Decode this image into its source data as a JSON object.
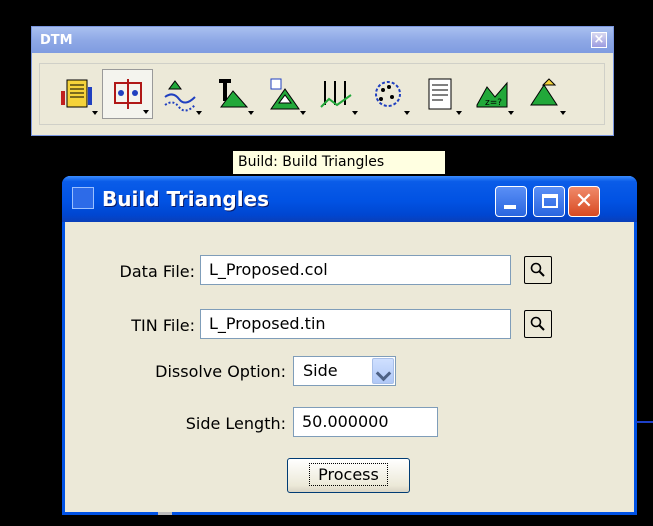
{
  "toolbar_window": {
    "title": "DTM",
    "close_glyph": "×",
    "tools": [
      {
        "icon": "input-data-icon",
        "label": "Input"
      },
      {
        "icon": "edit-points-icon",
        "label": "Edit"
      },
      {
        "icon": "drape-icon",
        "label": "Drape"
      },
      {
        "icon": "triangle-build-icon",
        "label": "Build"
      },
      {
        "icon": "trim-triangles-icon",
        "label": "Trim"
      },
      {
        "icon": "contours-icon",
        "label": "Contours"
      },
      {
        "icon": "points-icon",
        "label": "Points"
      },
      {
        "icon": "report-icon",
        "label": "Report"
      },
      {
        "icon": "elevation-query-icon",
        "label": "Elevation"
      },
      {
        "icon": "view-icon",
        "label": "View"
      }
    ]
  },
  "tooltip": {
    "text": "Build: Build Triangles"
  },
  "dialog": {
    "title": "Build Triangles",
    "data_file": {
      "label": "Data File:",
      "value": "L_Proposed.col"
    },
    "tin_file": {
      "label": "TIN File:",
      "value": "L_Proposed.tin"
    },
    "dissolve_option": {
      "label": "Dissolve Option:",
      "value": "Side"
    },
    "side_length": {
      "label": "Side Length:",
      "value": "50.000000"
    },
    "process_label": "Process"
  },
  "colors": {
    "titlebar_blue": "#0152e3",
    "dialog_face": "#ece9d8",
    "close_red": "#d84a22",
    "tooltip_bg": "#ffffe1"
  }
}
